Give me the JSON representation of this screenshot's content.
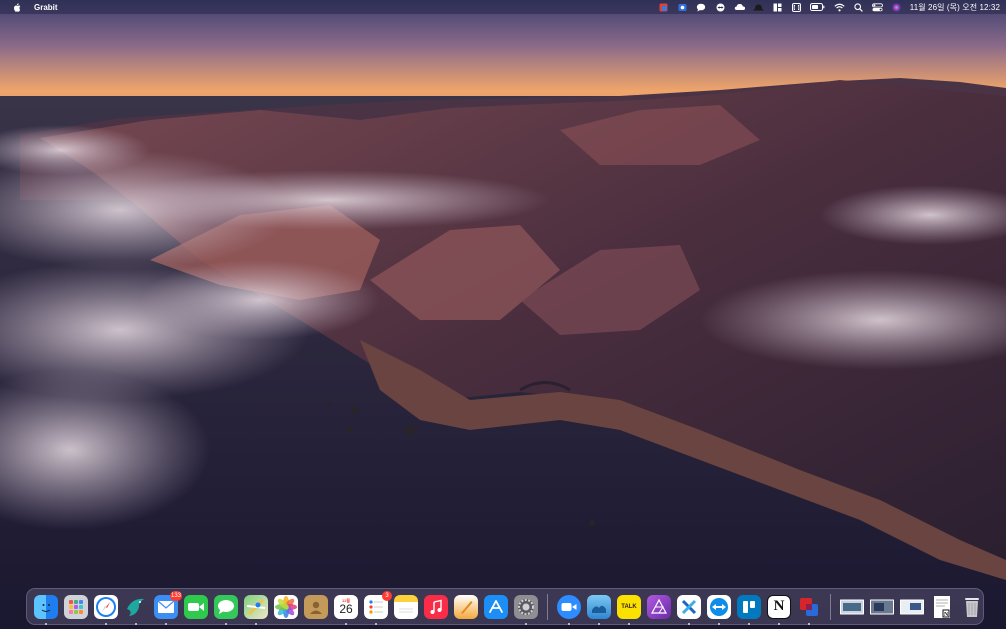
{
  "menubar": {
    "app_name": "Grabit",
    "clock": "11월 26일 (목) 오전 12:32",
    "status_icons": [
      "adobe-icon",
      "facetime-blue-icon",
      "messages-icon",
      "teamviewer-icon",
      "cloud-icon",
      "hat-icon",
      "layout-icon",
      "bracket-icon",
      "battery-icon",
      "wifi-icon",
      "search-icon",
      "control-center-icon",
      "siri-icon"
    ]
  },
  "dock": {
    "apps": [
      {
        "name": "finder",
        "icon": "finder-icon",
        "color": "#1e8ef5"
      },
      {
        "name": "launchpad",
        "icon": "launchpad-icon",
        "color": "#cfd2d8"
      },
      {
        "name": "safari",
        "icon": "safari-icon",
        "color": "#1c7ff2"
      },
      {
        "name": "grabit",
        "icon": "grabit-bird-icon",
        "color": "#1fa89f"
      },
      {
        "name": "mail",
        "icon": "mail-icon",
        "color": "#3d8ef4",
        "badge": "133"
      },
      {
        "name": "facetime",
        "icon": "facetime-icon",
        "color": "#2ec94d"
      },
      {
        "name": "messages",
        "icon": "messages-icon",
        "color": "#34c759"
      },
      {
        "name": "maps",
        "icon": "maps-icon",
        "color": "#5fb85f"
      },
      {
        "name": "photos",
        "icon": "photos-icon",
        "color": "#f4f4f4"
      },
      {
        "name": "contacts",
        "icon": "contacts-icon",
        "color": "#c49a5a"
      },
      {
        "name": "calendar",
        "icon": "calendar-icon",
        "color": "#ffffff",
        "cal_month": "11월",
        "cal_day": "26"
      },
      {
        "name": "reminders",
        "icon": "reminders-icon",
        "color": "#ffffff",
        "badge": "3"
      },
      {
        "name": "notes",
        "icon": "notes-icon",
        "color": "#fbd13d"
      },
      {
        "name": "music",
        "icon": "music-icon",
        "color": "#fa2d48"
      },
      {
        "name": "pages",
        "icon": "pages-icon",
        "color": "#f2a93b"
      },
      {
        "name": "app-store",
        "icon": "app-store-icon",
        "color": "#1c8ef5"
      },
      {
        "name": "system-preferences",
        "icon": "gear-icon",
        "color": "#8e8e93"
      },
      {
        "name": "zoom",
        "icon": "zoom-icon",
        "color": "#2d8cff"
      },
      {
        "name": "preview",
        "icon": "preview-icon",
        "color": "#3aa0e8"
      },
      {
        "name": "kakaotalk",
        "icon": "kakaotalk-icon",
        "color": "#fae100",
        "label": "TALK"
      },
      {
        "name": "affinity-photo",
        "icon": "affinity-icon",
        "color": "#8e3fc0"
      },
      {
        "name": "xcode-x",
        "icon": "x-icon",
        "color": "#ffffff"
      },
      {
        "name": "teamviewer",
        "icon": "teamviewer-icon",
        "color": "#0e8ee9"
      },
      {
        "name": "trello",
        "icon": "trello-icon",
        "color": "#0079bf"
      },
      {
        "name": "notion",
        "icon": "notion-icon",
        "color": "#ffffff",
        "label": "N"
      },
      {
        "name": "parallels",
        "icon": "parallels-icon",
        "color": "#d6262b"
      }
    ],
    "recents": [
      {
        "name": "screenshot-1",
        "icon": "screenshot-thumb-icon"
      },
      {
        "name": "screenshot-2",
        "icon": "screenshot-thumb-icon"
      },
      {
        "name": "screenshot-3",
        "icon": "screenshot-thumb-icon"
      },
      {
        "name": "document",
        "icon": "document-icon"
      },
      {
        "name": "trash",
        "icon": "trash-icon"
      }
    ]
  }
}
